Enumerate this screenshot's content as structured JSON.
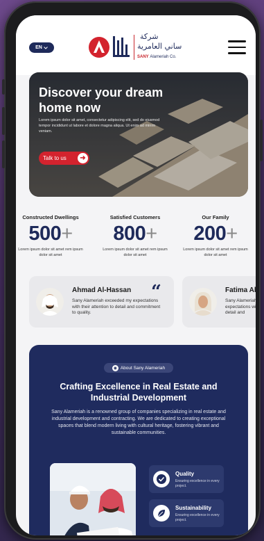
{
  "header": {
    "lang_label": "EN",
    "logo_ar_line1": "شركة",
    "logo_ar_line2": "ساني العامرية",
    "logo_en_brand": "SANY",
    "logo_en_name": "Alameriah Co."
  },
  "hero": {
    "title": "Discover your dream home now",
    "text": "Lorem ipsum dolor sit amet, consectetur adipiscing elit, sed do eiusmod tempor incididunt ut labore et dolore magna aliqua. Ut enim ad minim veniam.",
    "cta_label": "Talk to us",
    "cta_icon": "arrow-right-icon"
  },
  "stats": [
    {
      "label": "Constructed Dwellings",
      "value": "500",
      "plus": "+",
      "desc": "Lorem ipsum dolor sit amet rem ipsum dolor sit amet"
    },
    {
      "label": "Satisfied Customers",
      "value": "800",
      "plus": "+",
      "desc": "Lorem ipsum dolor sit amet rem ipsum dolor sit amet"
    },
    {
      "label": "Our Family",
      "value": "200",
      "plus": "+",
      "desc": "Lorem ipsum dolor sit amet rem ipsum dolor sit amet"
    }
  ],
  "testimonials": [
    {
      "name": "Ahmad Al-Hassan",
      "text": "Sany Alameriah exceeded my expectations with their attention to detail and commitment to quality."
    },
    {
      "name": "Fatima Al",
      "text": "Sany Alameriah expectations with to detail and"
    }
  ],
  "quote_glyph": "“",
  "about": {
    "pill_label": "About Sany Alameriah",
    "title": "Crafting Excellence in Real Estate and Industrial Development",
    "text": "Sany Alameriah is a renowned group of companies specializing in real estate and industrial development and contracting. We are dedicated to creating exceptional spaces that blend modern living with cultural heritage, fostering vibrant and sustainable communities.",
    "features": [
      {
        "title": "Quality",
        "text": "Ensuring excellence in every project.",
        "icon": "check-badge-icon"
      },
      {
        "title": "Sustainability",
        "text": "Ensuring excellence in every project.",
        "icon": "leaf-icon"
      }
    ]
  },
  "colors": {
    "brand_navy": "#1e2a5a",
    "brand_red": "#d3232e",
    "background": "#f4f4f6"
  }
}
